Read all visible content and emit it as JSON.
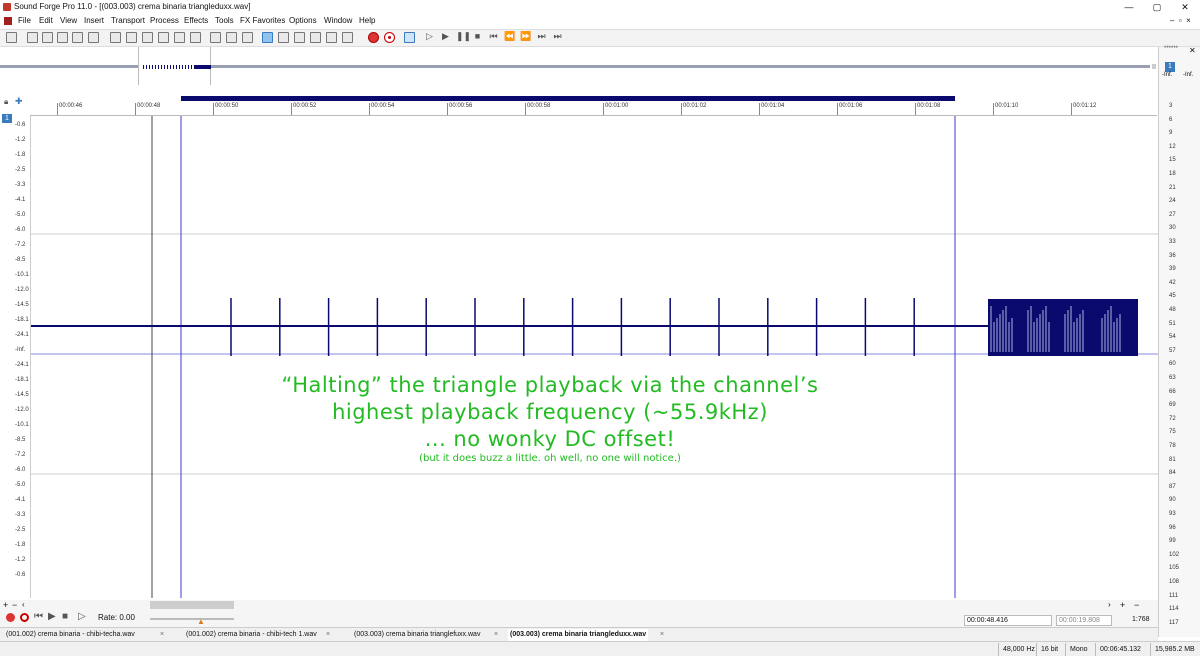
{
  "window": {
    "title": "Sound Forge Pro 11.0 - [(003.003) crema binaria triangleduxx.wav]",
    "controls": [
      "—",
      "▢",
      "✕"
    ]
  },
  "menu": [
    "File",
    "Edit",
    "View",
    "Insert",
    "Transport",
    "Process",
    "Effects",
    "Tools",
    "FX Favorites",
    "Options",
    "Window",
    "Help"
  ],
  "ruler": {
    "ticks": [
      "00:00:46",
      "00:00:48",
      "00:00:50",
      "00:00:52",
      "00:00:54",
      "00:00:56",
      "00:00:58",
      "00:01:00",
      "00:01:02",
      "00:01:04",
      "00:01:06",
      "00:01:08",
      "00:01:10",
      "00:01:12"
    ]
  },
  "channel_badge": "1",
  "left_scale": [
    "-0.6",
    "-1.2",
    "-1.8",
    "-2.5",
    "-3.3",
    "-4.1",
    "-5.0",
    "-6.0",
    "-7.2",
    "-8.5",
    "-10.1",
    "-12.0",
    "-14.5",
    "-18.1",
    "-24.1",
    "-Inf.",
    "-24.1",
    "-18.1",
    "-14.5",
    "-12.0",
    "-10.1",
    "-8.5",
    "-7.2",
    "-6.0",
    "-5.0",
    "-4.1",
    "-3.3",
    "-2.5",
    "-1.8",
    "-1.2",
    "-0.6"
  ],
  "meter": {
    "header": "******",
    "badge": "1",
    "left_value": "-Inf.",
    "right_value": "-Inf.",
    "scale": [
      "3",
      "6",
      "9",
      "12",
      "15",
      "18",
      "21",
      "24",
      "27",
      "30",
      "33",
      "36",
      "39",
      "42",
      "45",
      "48",
      "51",
      "54",
      "57",
      "60",
      "63",
      "66",
      "69",
      "72",
      "75",
      "78",
      "81",
      "84",
      "87",
      "90",
      "93",
      "96",
      "99",
      "102",
      "105",
      "108",
      "111",
      "114",
      "117"
    ]
  },
  "annotation": {
    "line1": "“Halting” the triangle playback via the channel’s",
    "line2": "highest playback frequency (~55.9kHz)",
    "line3": "... no wonky DC offset!",
    "line4": "(but it does buzz a little. oh well, no one will notice.)",
    "color": "#22bb22"
  },
  "transport": {
    "rate_label": "Rate: 0.00",
    "position": "00:00:48.416",
    "length": "00:00:19.808",
    "zoom": "1:768"
  },
  "documents": [
    {
      "name": "(001.002) crema binaria - chibi-techa.wav",
      "active": false
    },
    {
      "name": "(001.002) crema binaria - chibi-tech 1.wav",
      "active": false
    },
    {
      "name": "(003.003) crema binaria trianglefuxx.wav",
      "active": false
    },
    {
      "name": "(003.003) crema binaria triangleduxx.wav",
      "active": true
    }
  ],
  "status": {
    "sample_rate": "48,000 Hz",
    "bit_depth": "16 bit",
    "channels": "Mono",
    "duration": "00:06:45.132",
    "size": "15,985.2 MB"
  },
  "colors": {
    "waveform": "#0a0a6e",
    "selection_line": "#3a3ad0",
    "annotation": "#22bb22"
  }
}
